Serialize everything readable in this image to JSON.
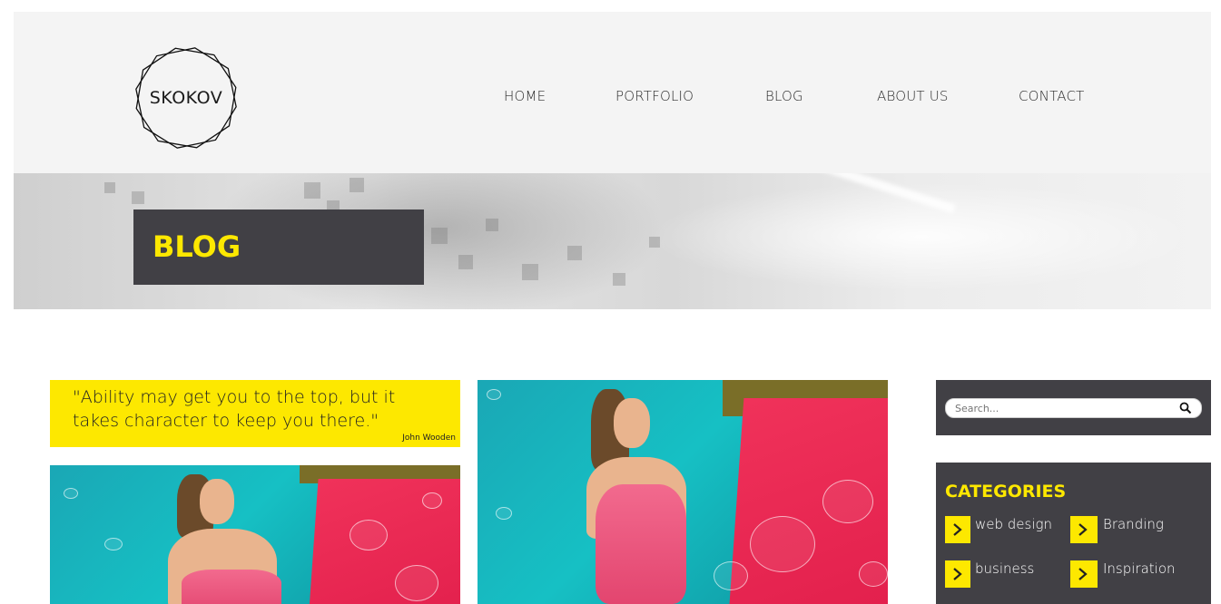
{
  "header": {
    "logo_text": "SKOKOV",
    "nav": [
      {
        "label": "HOME"
      },
      {
        "label": "PORTFOLIO"
      },
      {
        "label": "BLOG"
      },
      {
        "label": "ABOUT US"
      },
      {
        "label": "CONTACT"
      }
    ]
  },
  "banner": {
    "title": "BLOG"
  },
  "quote": {
    "text": "\"Ability may get you to the top, but it takes character to keep you there.\"",
    "author": "John Wooden"
  },
  "sidebar": {
    "search": {
      "placeholder": "Search..."
    },
    "categories": {
      "title": "CATEGORIES",
      "items": [
        {
          "label": "web design"
        },
        {
          "label": "Branding"
        },
        {
          "label": "business"
        },
        {
          "label": "Inspiration"
        }
      ]
    }
  },
  "colors": {
    "accent": "#fde800",
    "panel": "#414045",
    "header_bg": "#f4f4f4"
  },
  "icons": [
    "logo-octagon-icon",
    "search-icon",
    "chevron-right-icon"
  ]
}
